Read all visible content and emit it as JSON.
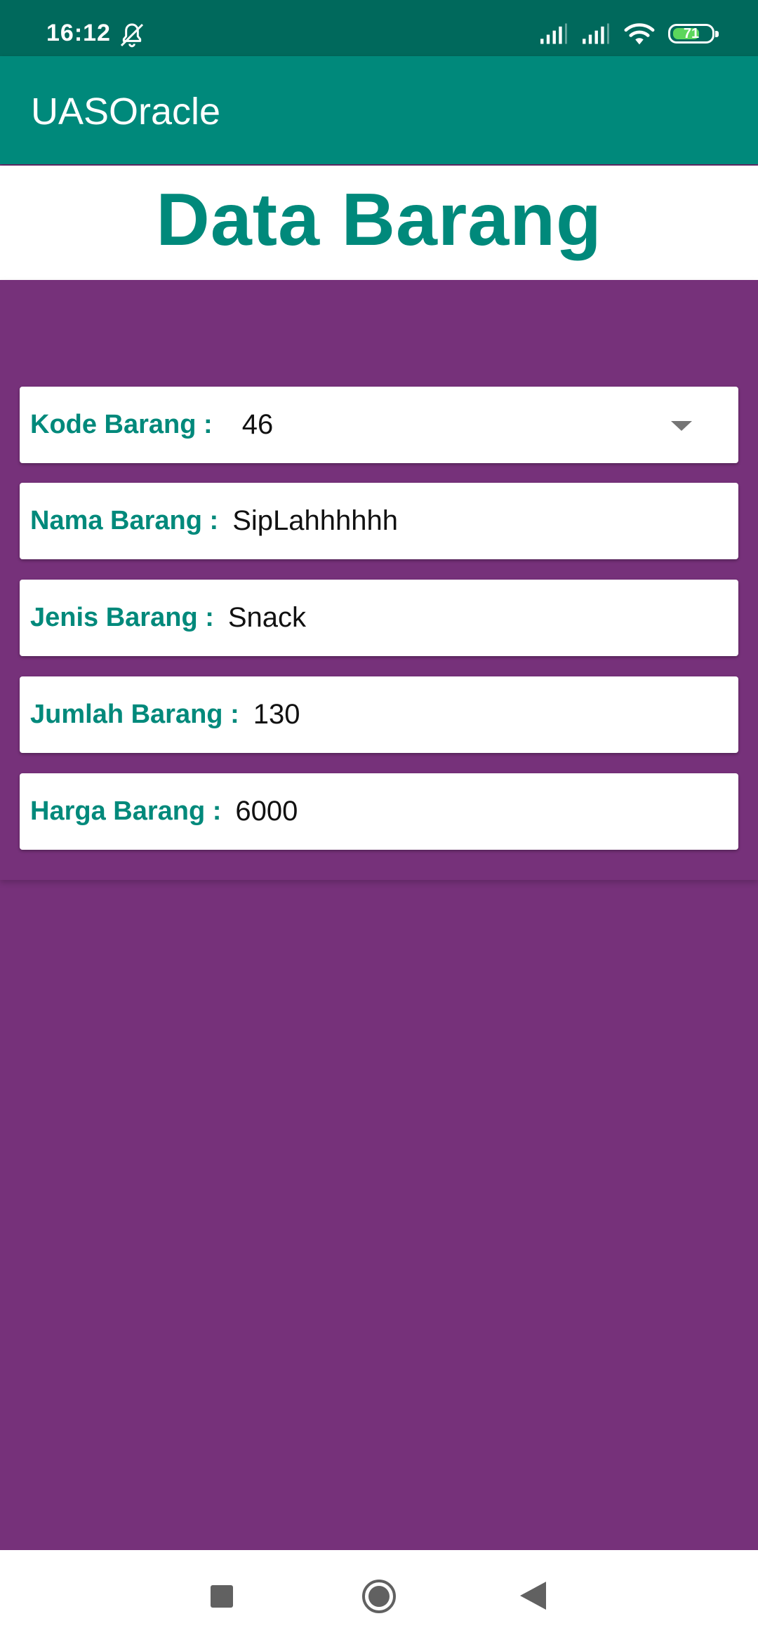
{
  "status_bar": {
    "time": "16:12",
    "battery_level": "71",
    "battery_percent": 71,
    "icons": [
      "bell-off-icon",
      "signal-icon",
      "signal-icon",
      "wifi-icon",
      "battery-icon"
    ]
  },
  "app_bar": {
    "title": "UASOracle"
  },
  "header": {
    "title": "Data Barang"
  },
  "form": {
    "kode": {
      "label": "Kode Barang :",
      "value": "46"
    },
    "nama": {
      "label": "Nama Barang :",
      "value": "SipLahhhhhh"
    },
    "jenis": {
      "label": "Jenis Barang :",
      "value": "Snack"
    },
    "jumlah": {
      "label": "Jumlah Barang :",
      "value": "130"
    },
    "harga": {
      "label": "Harga Barang :",
      "value": "6000"
    }
  },
  "nav_bar": {
    "buttons": [
      "recents-icon",
      "home-icon",
      "back-icon"
    ]
  },
  "colors": {
    "status_bar": "#00695c",
    "app_bar": "#00897b",
    "accent_text": "#00897b",
    "background": "#76317a",
    "card": "#ffffff"
  }
}
